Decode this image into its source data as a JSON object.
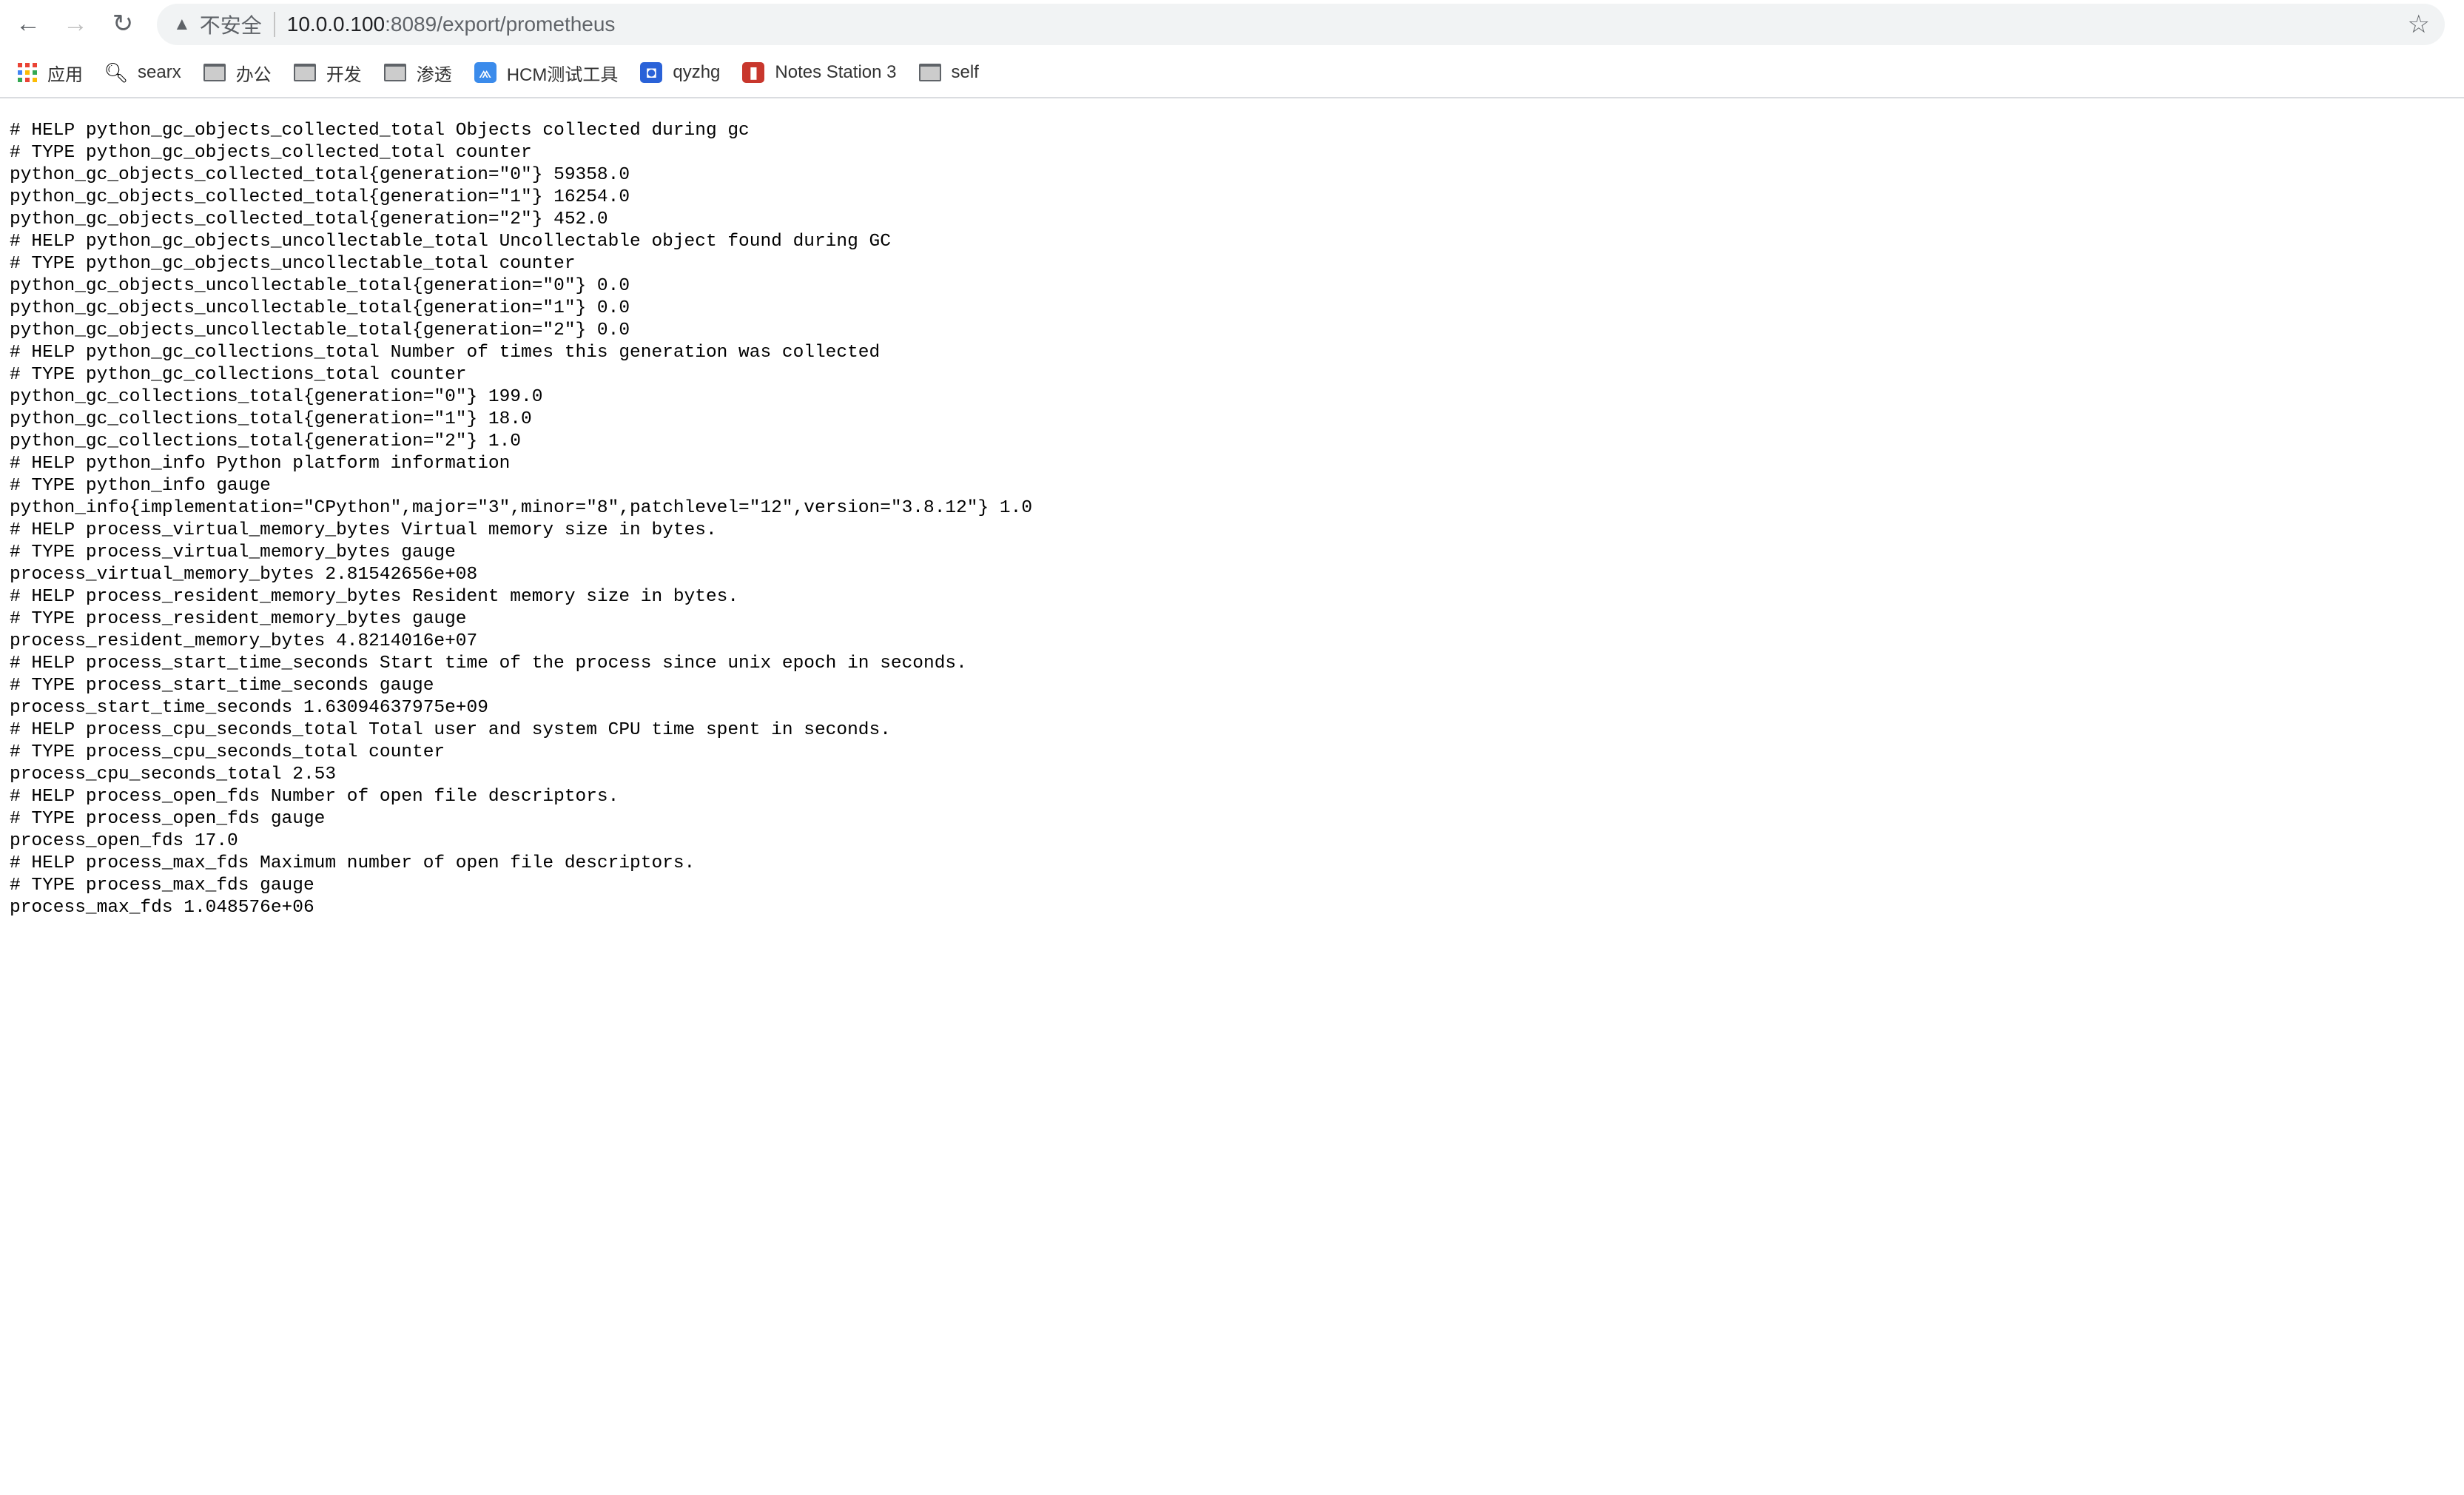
{
  "browser": {
    "security_label": "不安全",
    "url_host": "10.0.0.100",
    "url_path": ":8089/export/prometheus",
    "icons": {
      "back": "arrow-left",
      "forward": "arrow-right",
      "reload": "reload",
      "warning": "warning-triangle",
      "bookmark": "star"
    }
  },
  "bookmarks": [
    {
      "label": "应用",
      "icon": "apps-grid"
    },
    {
      "label": "searx",
      "icon": "search"
    },
    {
      "label": "办公",
      "icon": "folder"
    },
    {
      "label": "开发",
      "icon": "folder"
    },
    {
      "label": "渗透",
      "icon": "folder"
    },
    {
      "label": "HCM测试工具",
      "icon": "hcm-logo",
      "color": "#3b8beb"
    },
    {
      "label": "qyzhg",
      "icon": "qyzhg-logo",
      "color": "#2a62d8"
    },
    {
      "label": "Notes Station 3",
      "icon": "notes-logo",
      "color": "#c8372d"
    },
    {
      "label": "self",
      "icon": "folder"
    }
  ],
  "lines": [
    "# HELP python_gc_objects_collected_total Objects collected during gc",
    "# TYPE python_gc_objects_collected_total counter",
    "python_gc_objects_collected_total{generation=\"0\"} 59358.0",
    "python_gc_objects_collected_total{generation=\"1\"} 16254.0",
    "python_gc_objects_collected_total{generation=\"2\"} 452.0",
    "# HELP python_gc_objects_uncollectable_total Uncollectable object found during GC",
    "# TYPE python_gc_objects_uncollectable_total counter",
    "python_gc_objects_uncollectable_total{generation=\"0\"} 0.0",
    "python_gc_objects_uncollectable_total{generation=\"1\"} 0.0",
    "python_gc_objects_uncollectable_total{generation=\"2\"} 0.0",
    "# HELP python_gc_collections_total Number of times this generation was collected",
    "# TYPE python_gc_collections_total counter",
    "python_gc_collections_total{generation=\"0\"} 199.0",
    "python_gc_collections_total{generation=\"1\"} 18.0",
    "python_gc_collections_total{generation=\"2\"} 1.0",
    "# HELP python_info Python platform information",
    "# TYPE python_info gauge",
    "python_info{implementation=\"CPython\",major=\"3\",minor=\"8\",patchlevel=\"12\",version=\"3.8.12\"} 1.0",
    "# HELP process_virtual_memory_bytes Virtual memory size in bytes.",
    "# TYPE process_virtual_memory_bytes gauge",
    "process_virtual_memory_bytes 2.81542656e+08",
    "# HELP process_resident_memory_bytes Resident memory size in bytes.",
    "# TYPE process_resident_memory_bytes gauge",
    "process_resident_memory_bytes 4.8214016e+07",
    "# HELP process_start_time_seconds Start time of the process since unix epoch in seconds.",
    "# TYPE process_start_time_seconds gauge",
    "process_start_time_seconds 1.63094637975e+09",
    "# HELP process_cpu_seconds_total Total user and system CPU time spent in seconds.",
    "# TYPE process_cpu_seconds_total counter",
    "process_cpu_seconds_total 2.53",
    "# HELP process_open_fds Number of open file descriptors.",
    "# TYPE process_open_fds gauge",
    "process_open_fds 17.0",
    "# HELP process_max_fds Maximum number of open file descriptors.",
    "# TYPE process_max_fds gauge",
    "process_max_fds 1.048576e+06"
  ]
}
